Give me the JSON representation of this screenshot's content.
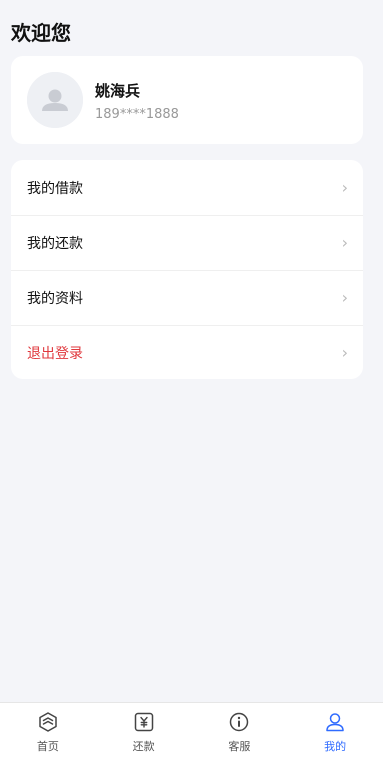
{
  "header": {
    "title": "欢迎您"
  },
  "profile": {
    "name": "姚海兵",
    "phone": "189****1888"
  },
  "menu": {
    "items": [
      {
        "label": "我的借款"
      },
      {
        "label": "我的还款"
      },
      {
        "label": "我的资料"
      },
      {
        "label": "退出登录"
      }
    ],
    "chevron": "›"
  },
  "tabbar": {
    "tabs": [
      {
        "label": "首页",
        "icon": "home-icon"
      },
      {
        "label": "还款",
        "icon": "repay-icon"
      },
      {
        "label": "客服",
        "icon": "info-icon"
      },
      {
        "label": "我的",
        "icon": "user-icon"
      }
    ],
    "active_index": 3,
    "active_color": "#2f6bff",
    "logout_color": "#e0393e"
  }
}
